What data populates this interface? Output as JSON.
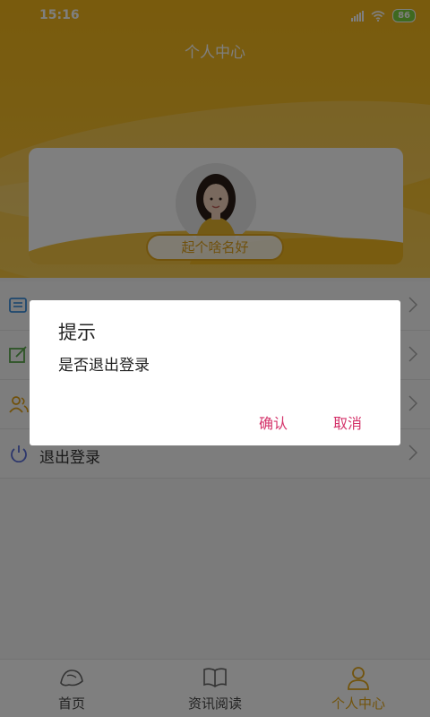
{
  "status_bar": {
    "time": "15:16",
    "battery": "86"
  },
  "header": {
    "title": "个人中心"
  },
  "profile": {
    "nickname_button": "起个啥名好"
  },
  "menu": {
    "items": [
      {
        "label": "",
        "icon": "document-icon"
      },
      {
        "label": "",
        "icon": "edit-icon"
      },
      {
        "label": "",
        "icon": "users-icon"
      },
      {
        "label": "退出登录",
        "icon": "power-icon"
      }
    ]
  },
  "bottom_nav": {
    "items": [
      {
        "label": "首页",
        "icon": "home-icon",
        "active": false
      },
      {
        "label": "资讯阅读",
        "icon": "book-icon",
        "active": false
      },
      {
        "label": "个人中心",
        "icon": "person-icon",
        "active": true
      }
    ]
  },
  "dialog": {
    "title": "提示",
    "message": "是否退出登录",
    "confirm_label": "确认",
    "cancel_label": "取消"
  },
  "colors": {
    "header": "#f2b61a",
    "accent": "#e5a81b",
    "dialog_button": "#d4336a",
    "battery": "#7cd33f"
  }
}
